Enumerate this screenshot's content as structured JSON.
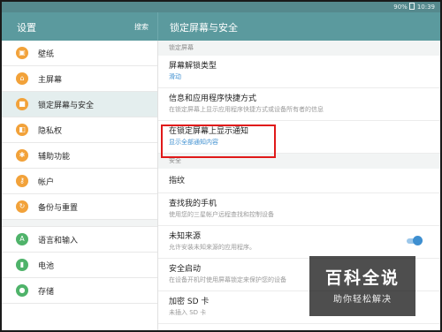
{
  "status": {
    "battery": "90%",
    "time": "10:39"
  },
  "header": {
    "settings_title": "设置",
    "search_label": "搜索",
    "page_title": "锁定屏幕与安全"
  },
  "sidebar": {
    "items": [
      {
        "label": "壁纸",
        "icon": "wallpaper-icon"
      },
      {
        "label": "主屏幕",
        "icon": "home-icon"
      },
      {
        "label": "锁定屏幕与安全",
        "icon": "lock-icon",
        "active": true
      },
      {
        "label": "隐私权",
        "icon": "privacy-icon"
      },
      {
        "label": "辅助功能",
        "icon": "accessibility-icon"
      },
      {
        "label": "帐户",
        "icon": "account-key-icon"
      },
      {
        "label": "备份与重置",
        "icon": "backup-icon"
      },
      {
        "label": "语言和输入",
        "icon": "language-icon"
      },
      {
        "label": "电池",
        "icon": "battery-icon"
      },
      {
        "label": "存储",
        "icon": "storage-icon"
      }
    ]
  },
  "content": {
    "section_lock": "锁定屏幕",
    "section_security": "安全",
    "rows": [
      {
        "title": "屏幕解锁类型",
        "sub": "滑动"
      },
      {
        "title": "信息和应用程序快捷方式",
        "sub": "在锁定屏幕上显示应用程序快捷方式或设备所有者的信息"
      },
      {
        "title": "在锁定屏幕上显示通知",
        "sub": "显示全部通知内容"
      },
      {
        "title": "指纹",
        "sub": ""
      },
      {
        "title": "查找我的手机",
        "sub": "使用您的三星帐户远程查找和控制设备"
      },
      {
        "title": "未知来源",
        "sub": "允许安装未知来源的应用程序。",
        "toggle": true
      },
      {
        "title": "安全启动",
        "sub": "在设备开机时使用屏幕锁定来保护您的设备"
      },
      {
        "title": "加密 SD 卡",
        "sub": "未插入 SD 卡"
      }
    ]
  },
  "watermark": {
    "main": "百科全说",
    "sub": "助你轻松解决"
  },
  "colors": {
    "header": "#5b9a9e",
    "accent": "#3e8fd0",
    "highlight": "#e01a1a",
    "icon_orange": "#f2a23a",
    "icon_green": "#4fb36a"
  }
}
